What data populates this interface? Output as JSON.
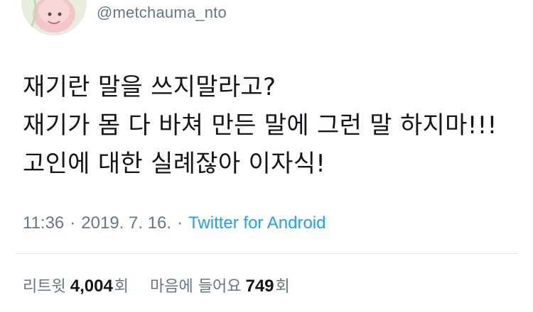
{
  "user": {
    "handle": "@metchauma_nto"
  },
  "tweet": {
    "lines": [
      "재기란 말을 쓰지말라고?",
      "재기가 몸 다 바쳐 만든 말에 그런 말 하지마!!!",
      "고인에 대한 실례잖아 이자식!"
    ],
    "time": "11:36",
    "separator": "·",
    "date": "2019. 7. 16.",
    "source": "Twitter for Android"
  },
  "stats": {
    "retweets_label": "리트윗",
    "retweets_count": "4,004",
    "retweets_unit": "회",
    "likes_label": "마음에 들어요",
    "likes_count": "749",
    "likes_unit": "회"
  },
  "colors": {
    "text": "#14171a",
    "muted": "#657786",
    "link": "#1da1f2",
    "divider": "#e1e8ed"
  }
}
